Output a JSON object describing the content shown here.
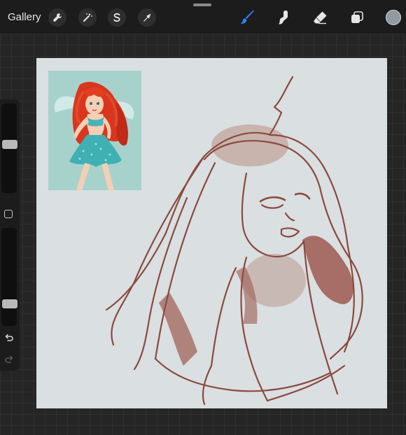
{
  "topbar": {
    "gallery_label": "Gallery",
    "left_tools": [
      {
        "icon": "wrench-icon",
        "name": "actions"
      },
      {
        "icon": "magic-wand-icon",
        "name": "adjustments"
      },
      {
        "icon": "selection-s-icon",
        "name": "selection"
      },
      {
        "icon": "arrow-cursor-icon",
        "name": "transform"
      }
    ],
    "right_tools": [
      {
        "icon": "brush-icon",
        "name": "brush",
        "active": true
      },
      {
        "icon": "smudge-icon",
        "name": "smudge",
        "active": false
      },
      {
        "icon": "eraser-icon",
        "name": "eraser",
        "active": false
      },
      {
        "icon": "layers-icon",
        "name": "layers",
        "active": false
      }
    ],
    "current_color": "#8f9aa3",
    "active_tool_color": "#2f82f5"
  },
  "sidebar": {
    "brush_size_level": 0.55,
    "opacity_level": 0.2,
    "undo_icon": "undo-icon",
    "redo_icon": "redo-icon"
  },
  "canvas": {
    "background": "#dadfe1",
    "sketch_color": "#8a4a3f",
    "reference_image": "reference-photo-red-haired-fairy"
  }
}
